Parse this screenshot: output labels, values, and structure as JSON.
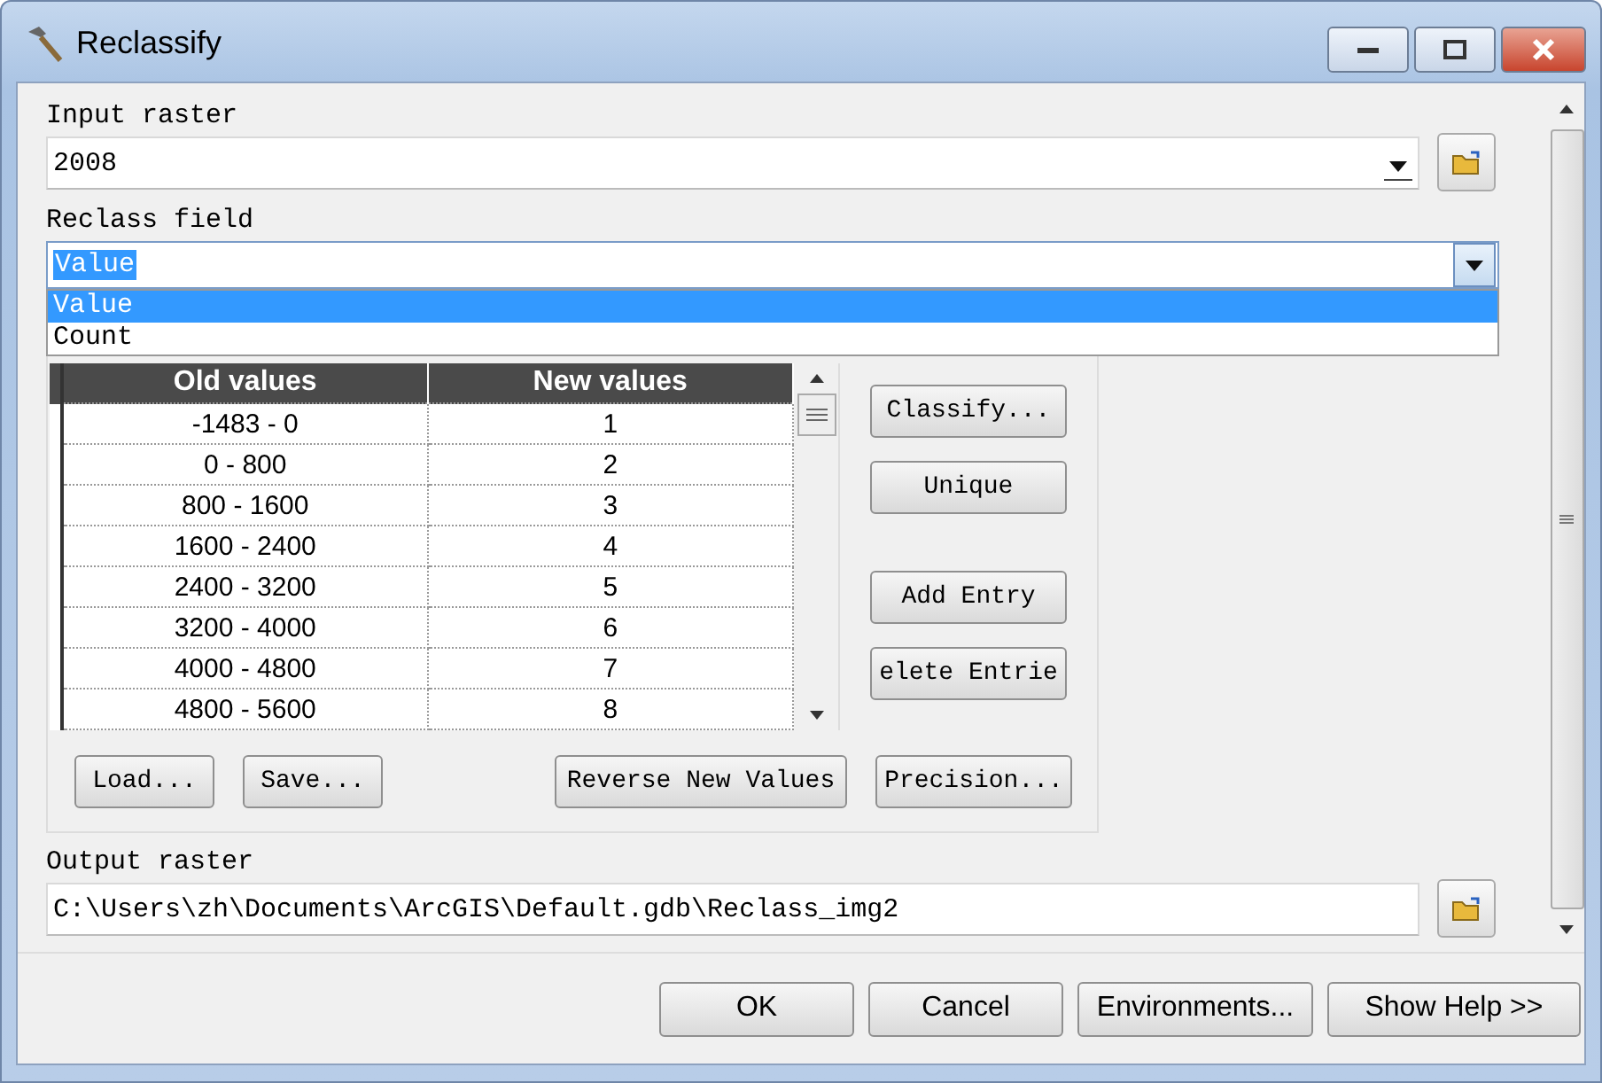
{
  "window": {
    "title": "Reclassify"
  },
  "input_raster": {
    "label": "Input raster",
    "value": "2008"
  },
  "reclass_field": {
    "label": "Reclass field",
    "value": "Value",
    "expanded": true,
    "options": [
      {
        "label": "Value",
        "selected": true
      },
      {
        "label": "Count",
        "selected": false
      }
    ]
  },
  "reclass_table": {
    "columns": [
      "Old values",
      "New values"
    ],
    "rows": [
      {
        "old": "-1483 - 0",
        "new": "1"
      },
      {
        "old": "0 - 800",
        "new": "2"
      },
      {
        "old": "800 - 1600",
        "new": "3"
      },
      {
        "old": "1600 - 2400",
        "new": "4"
      },
      {
        "old": "2400 - 3200",
        "new": "5"
      },
      {
        "old": "3200 - 4000",
        "new": "6"
      },
      {
        "old": "4000 - 4800",
        "new": "7"
      },
      {
        "old": "4800 - 5600",
        "new": "8"
      }
    ]
  },
  "side_buttons": [
    "Classify...",
    "Unique",
    "Add Entry",
    "elete Entrie"
  ],
  "bottom_buttons": [
    "Load...",
    "Save...",
    "Reverse New Values",
    "Precision..."
  ],
  "output_raster": {
    "label": "Output raster",
    "value": "C:\\Users\\zh\\Documents\\ArcGIS\\Default.gdb\\Reclass_img2"
  },
  "dialog_buttons": [
    "OK",
    "Cancel",
    "Environments...",
    "Show Help >>"
  ]
}
